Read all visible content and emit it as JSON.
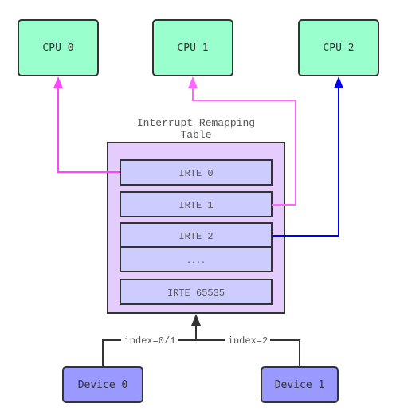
{
  "diagram": {
    "cpus": [
      {
        "id": "cpu0",
        "label": "CPU 0"
      },
      {
        "id": "cpu1",
        "label": "CPU 1"
      },
      {
        "id": "cpu2",
        "label": "CPU 2"
      }
    ],
    "table": {
      "title_line1": "Interrupt Remapping",
      "title_line2": "Table",
      "entries": [
        {
          "id": "irte0",
          "label": "IRTE 0"
        },
        {
          "id": "irte1",
          "label": "IRTE 1"
        },
        {
          "id": "irte2",
          "label": "IRTE 2"
        },
        {
          "id": "ellipsis",
          "label": "...."
        },
        {
          "id": "irte65535",
          "label": "IRTE 65535"
        }
      ]
    },
    "devices": [
      {
        "id": "device0",
        "label": "Device 0"
      },
      {
        "id": "device1",
        "label": "Device 1"
      }
    ],
    "edges": [
      {
        "from": "irte0",
        "to": "cpu0",
        "color": "#ff44ff"
      },
      {
        "from": "irte1",
        "to": "cpu1",
        "color": "#ff66ff"
      },
      {
        "from": "irte2",
        "to": "cpu2",
        "color": "#0000ee"
      },
      {
        "from": "device0",
        "to": "table",
        "label": "index=0/1",
        "color": "#333333"
      },
      {
        "from": "device1",
        "to": "table",
        "label": "index=2",
        "color": "#333333"
      }
    ],
    "colors": {
      "cpu_fill": "#99ffcc",
      "table_fill": "#e5ccff",
      "entry_fill": "#ccccff",
      "device_fill": "#9999ff",
      "stroke": "#333333"
    }
  }
}
